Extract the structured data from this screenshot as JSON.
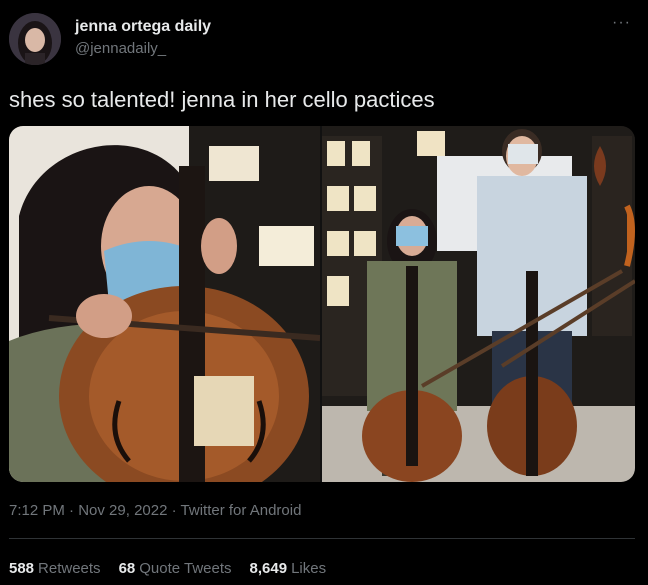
{
  "author": {
    "display_name": "jenna ortega daily",
    "handle": "@jennadaily_"
  },
  "tweet": {
    "text": "shes so talented! jenna in her cello pactices",
    "time": "7:12 PM",
    "sep1": "·",
    "date": "Nov 29, 2022",
    "sep2": "·",
    "source": "Twitter for Android"
  },
  "stats": {
    "retweets_count": "588",
    "retweets_label": "Retweets",
    "quote_count": "68",
    "quote_label": "Quote Tweets",
    "likes_count": "8,649",
    "likes_label": "Likes"
  },
  "more_icon": "more-options-icon",
  "colors": {
    "background": "#000000",
    "primary_text": "#e7e9ea",
    "secondary_text": "#71767b",
    "divider": "#2f3336"
  }
}
